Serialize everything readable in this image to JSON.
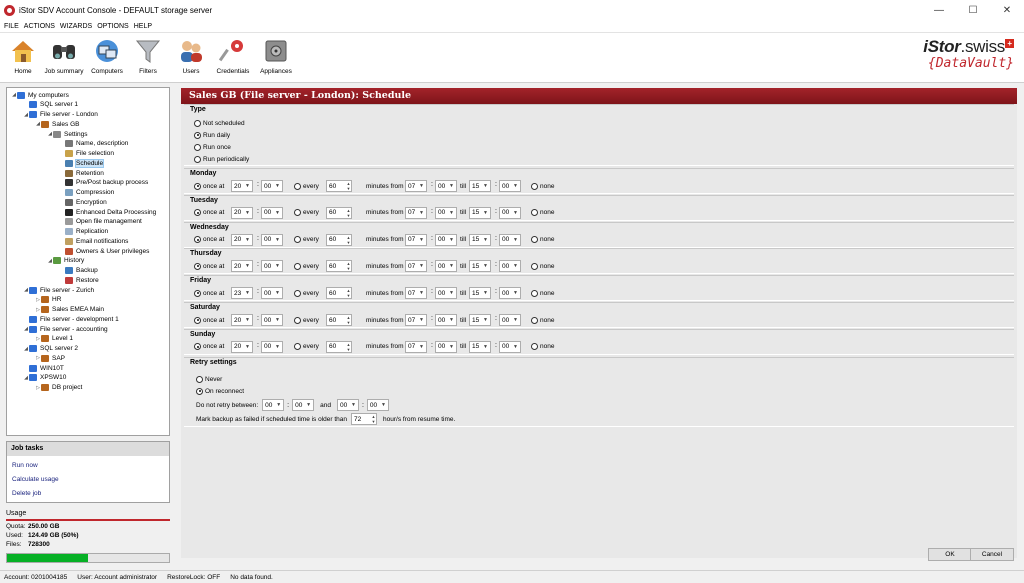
{
  "window": {
    "title": "iStor SDV Account Console - DEFAULT storage server",
    "minimize": "—",
    "maximize": "☐",
    "close": "✕"
  },
  "menu": [
    "FILE",
    "ACTIONS",
    "WIZARDS",
    "OPTIONS",
    "HELP"
  ],
  "toolbar": {
    "buttons": [
      {
        "label": "Home",
        "icon": "home-icon"
      },
      {
        "label": "Job summary",
        "icon": "binoculars-icon"
      },
      {
        "label": "Computers",
        "icon": "computers-icon"
      },
      {
        "label": "Filters",
        "icon": "funnel-icon"
      },
      {
        "label": "Users",
        "icon": "users-icon"
      },
      {
        "label": "Credentials",
        "icon": "key-icon"
      },
      {
        "label": "Appliances",
        "icon": "safe-icon"
      }
    ]
  },
  "logo": {
    "brand": "iStor",
    "suffix": ".swiss",
    "cross": "+",
    "product": "{DataVault}"
  },
  "tree": [
    {
      "label": "My computers",
      "level": 0,
      "exp": "◢",
      "color": "#2f6fd6"
    },
    {
      "label": "SQL server 1",
      "level": 1,
      "exp": "",
      "color": "#2f6fd6"
    },
    {
      "label": "File server - London",
      "level": 1,
      "exp": "◢",
      "color": "#2f6fd6"
    },
    {
      "label": "Sales GB",
      "level": 2,
      "exp": "◢",
      "color": "#b5651d"
    },
    {
      "label": "Settings",
      "level": 3,
      "exp": "◢",
      "color": "#888888"
    },
    {
      "label": "Name, description",
      "level": 4,
      "exp": "",
      "color": "#777777"
    },
    {
      "label": "File selection",
      "level": 4,
      "exp": "",
      "color": "#c8a24a"
    },
    {
      "label": "Schedule",
      "level": 4,
      "exp": "",
      "color": "#4a7fb0",
      "selected": true
    },
    {
      "label": "Retention",
      "level": 4,
      "exp": "",
      "color": "#8a6a3a"
    },
    {
      "label": "Pre/Post backup process",
      "level": 4,
      "exp": "",
      "color": "#333333"
    },
    {
      "label": "Compression",
      "level": 4,
      "exp": "",
      "color": "#7aa0c0"
    },
    {
      "label": "Encryption",
      "level": 4,
      "exp": "",
      "color": "#666666"
    },
    {
      "label": "Enhanced Delta Processing",
      "level": 4,
      "exp": "",
      "color": "#222222"
    },
    {
      "label": "Open file management",
      "level": 4,
      "exp": "",
      "color": "#9a9a9a"
    },
    {
      "label": "Replication",
      "level": 4,
      "exp": "",
      "color": "#9ab0c8"
    },
    {
      "label": "Email notifications",
      "level": 4,
      "exp": "",
      "color": "#c0a060"
    },
    {
      "label": "Owners & User privileges",
      "level": 4,
      "exp": "",
      "color": "#c05030"
    },
    {
      "label": "History",
      "level": 3,
      "exp": "◢",
      "color": "#5a9a40"
    },
    {
      "label": "Backup",
      "level": 4,
      "exp": "",
      "color": "#3a7ac0"
    },
    {
      "label": "Restore",
      "level": 4,
      "exp": "",
      "color": "#c03a3a"
    },
    {
      "label": "File server - Zurich",
      "level": 1,
      "exp": "◢",
      "color": "#2f6fd6"
    },
    {
      "label": "HR",
      "level": 2,
      "exp": "▷",
      "color": "#b5651d"
    },
    {
      "label": "Sales EMEA Main",
      "level": 2,
      "exp": "▷",
      "color": "#b5651d"
    },
    {
      "label": "File server - development 1",
      "level": 1,
      "exp": "",
      "color": "#2f6fd6"
    },
    {
      "label": "File server - accounting",
      "level": 1,
      "exp": "◢",
      "color": "#2f6fd6"
    },
    {
      "label": "Level 1",
      "level": 2,
      "exp": "▷",
      "color": "#b5651d"
    },
    {
      "label": "SQL server 2",
      "level": 1,
      "exp": "◢",
      "color": "#2f6fd6"
    },
    {
      "label": "SAP",
      "level": 2,
      "exp": "▷",
      "color": "#b5651d"
    },
    {
      "label": "WIN10T",
      "level": 1,
      "exp": "",
      "color": "#2f6fd6"
    },
    {
      "label": "XPSW10",
      "level": 1,
      "exp": "◢",
      "color": "#2f6fd6"
    },
    {
      "label": "DB project",
      "level": 2,
      "exp": "▷",
      "color": "#b5651d"
    }
  ],
  "job_tasks": {
    "title": "Job tasks",
    "links": [
      "Run now",
      "Calculate usage",
      "Delete job"
    ]
  },
  "usage": {
    "title": "Usage",
    "quota_label": "Quota:",
    "quota": "250.00 GB",
    "used_label": "Used:",
    "used": "124.49 GB (50%)",
    "files_label": "Files:",
    "files": "728300",
    "percent": 50
  },
  "main": {
    "header": "Sales GB (File server - London): Schedule",
    "type": {
      "title": "Type",
      "options": [
        {
          "label": "Not scheduled",
          "checked": false
        },
        {
          "label": "Run daily",
          "checked": true
        },
        {
          "label": "Run once",
          "checked": false
        },
        {
          "label": "Run periodically",
          "checked": false
        }
      ]
    },
    "labels": {
      "once_at": "once at",
      "every": "every",
      "minutes_from": "minutes from",
      "till": "till",
      "none": "none",
      "colon": ":"
    },
    "days": [
      {
        "name": "Monday",
        "h": "20",
        "m": "00",
        "every": "60",
        "fh": "07",
        "fm": "00",
        "th": "15",
        "tm": "00"
      },
      {
        "name": "Tuesday",
        "h": "20",
        "m": "00",
        "every": "60",
        "fh": "07",
        "fm": "00",
        "th": "15",
        "tm": "00"
      },
      {
        "name": "Wednesday",
        "h": "20",
        "m": "00",
        "every": "60",
        "fh": "07",
        "fm": "00",
        "th": "15",
        "tm": "00"
      },
      {
        "name": "Thursday",
        "h": "20",
        "m": "00",
        "every": "60",
        "fh": "07",
        "fm": "00",
        "th": "15",
        "tm": "00"
      },
      {
        "name": "Friday",
        "h": "23",
        "m": "00",
        "every": "60",
        "fh": "07",
        "fm": "00",
        "th": "15",
        "tm": "00"
      },
      {
        "name": "Saturday",
        "h": "20",
        "m": "00",
        "every": "60",
        "fh": "07",
        "fm": "00",
        "th": "15",
        "tm": "00"
      },
      {
        "name": "Sunday",
        "h": "20",
        "m": "00",
        "every": "60",
        "fh": "07",
        "fm": "00",
        "th": "15",
        "tm": "00"
      }
    ],
    "retry": {
      "title": "Retry settings",
      "never": "Never",
      "on_reconnect": "On reconnect",
      "no_retry_label": "Do not retry between:",
      "from_h": "00",
      "from_m": "00",
      "and": "and",
      "to_h": "00",
      "to_m": "00",
      "fail_label": "Mark backup as failed if scheduled time is older than",
      "fail_value": "72",
      "fail_suffix": "hour/s from resume time."
    },
    "ok": "OK",
    "cancel": "Cancel"
  },
  "status": {
    "account": "Account: 0201004185",
    "user": "User: Account administrator",
    "restore_lock": "RestoreLock: OFF",
    "data": "No data found."
  }
}
